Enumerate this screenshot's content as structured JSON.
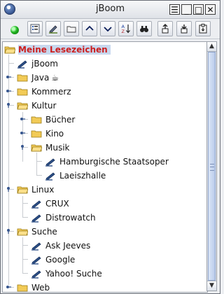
{
  "window": {
    "title": "jBoom",
    "controls": [
      "☰",
      "_",
      "□",
      "✕"
    ]
  },
  "toolbar": {
    "buttons": [
      "properties-icon",
      "edit-bookmark-icon",
      "new-folder-icon",
      "move-up-icon",
      "move-down-icon",
      "sort-alphabetical-icon",
      "find-icon",
      "import-icon",
      "export-icon",
      "clipboard-icon"
    ],
    "sort_label_a": "A",
    "sort_label_z": "Z"
  },
  "tree": {
    "root": "Meine Lesezeichen",
    "items": [
      {
        "label": "jBoom",
        "type": "bookmark"
      },
      {
        "label": "Java",
        "type": "folder",
        "state": "collapsed",
        "suffix": "☕"
      },
      {
        "label": "Kommerz",
        "type": "folder",
        "state": "collapsed"
      },
      {
        "label": "Kultur",
        "type": "folder",
        "state": "expanded"
      },
      {
        "label": "Bücher",
        "type": "folder",
        "state": "collapsed"
      },
      {
        "label": "Kino",
        "type": "folder",
        "state": "collapsed"
      },
      {
        "label": "Musik",
        "type": "folder",
        "state": "expanded"
      },
      {
        "label": "Hamburgische Staatsoper",
        "type": "bookmark"
      },
      {
        "label": "Laeiszhalle",
        "type": "bookmark"
      },
      {
        "label": "Linux",
        "type": "folder",
        "state": "expanded"
      },
      {
        "label": "CRUX",
        "type": "bookmark"
      },
      {
        "label": "Distrowatch",
        "type": "bookmark"
      },
      {
        "label": "Suche",
        "type": "folder",
        "state": "expanded"
      },
      {
        "label": "Ask Jeeves",
        "type": "bookmark"
      },
      {
        "label": "Google",
        "type": "bookmark"
      },
      {
        "label": "Yahoo! Suche",
        "type": "bookmark"
      },
      {
        "label": "Web",
        "type": "folder",
        "state": "collapsed"
      }
    ]
  },
  "colors": {
    "root_label": "#cc1f1f",
    "selection": "#c8d8ee",
    "folder": "#f2cb57",
    "bookmark": "#2d4f87"
  }
}
